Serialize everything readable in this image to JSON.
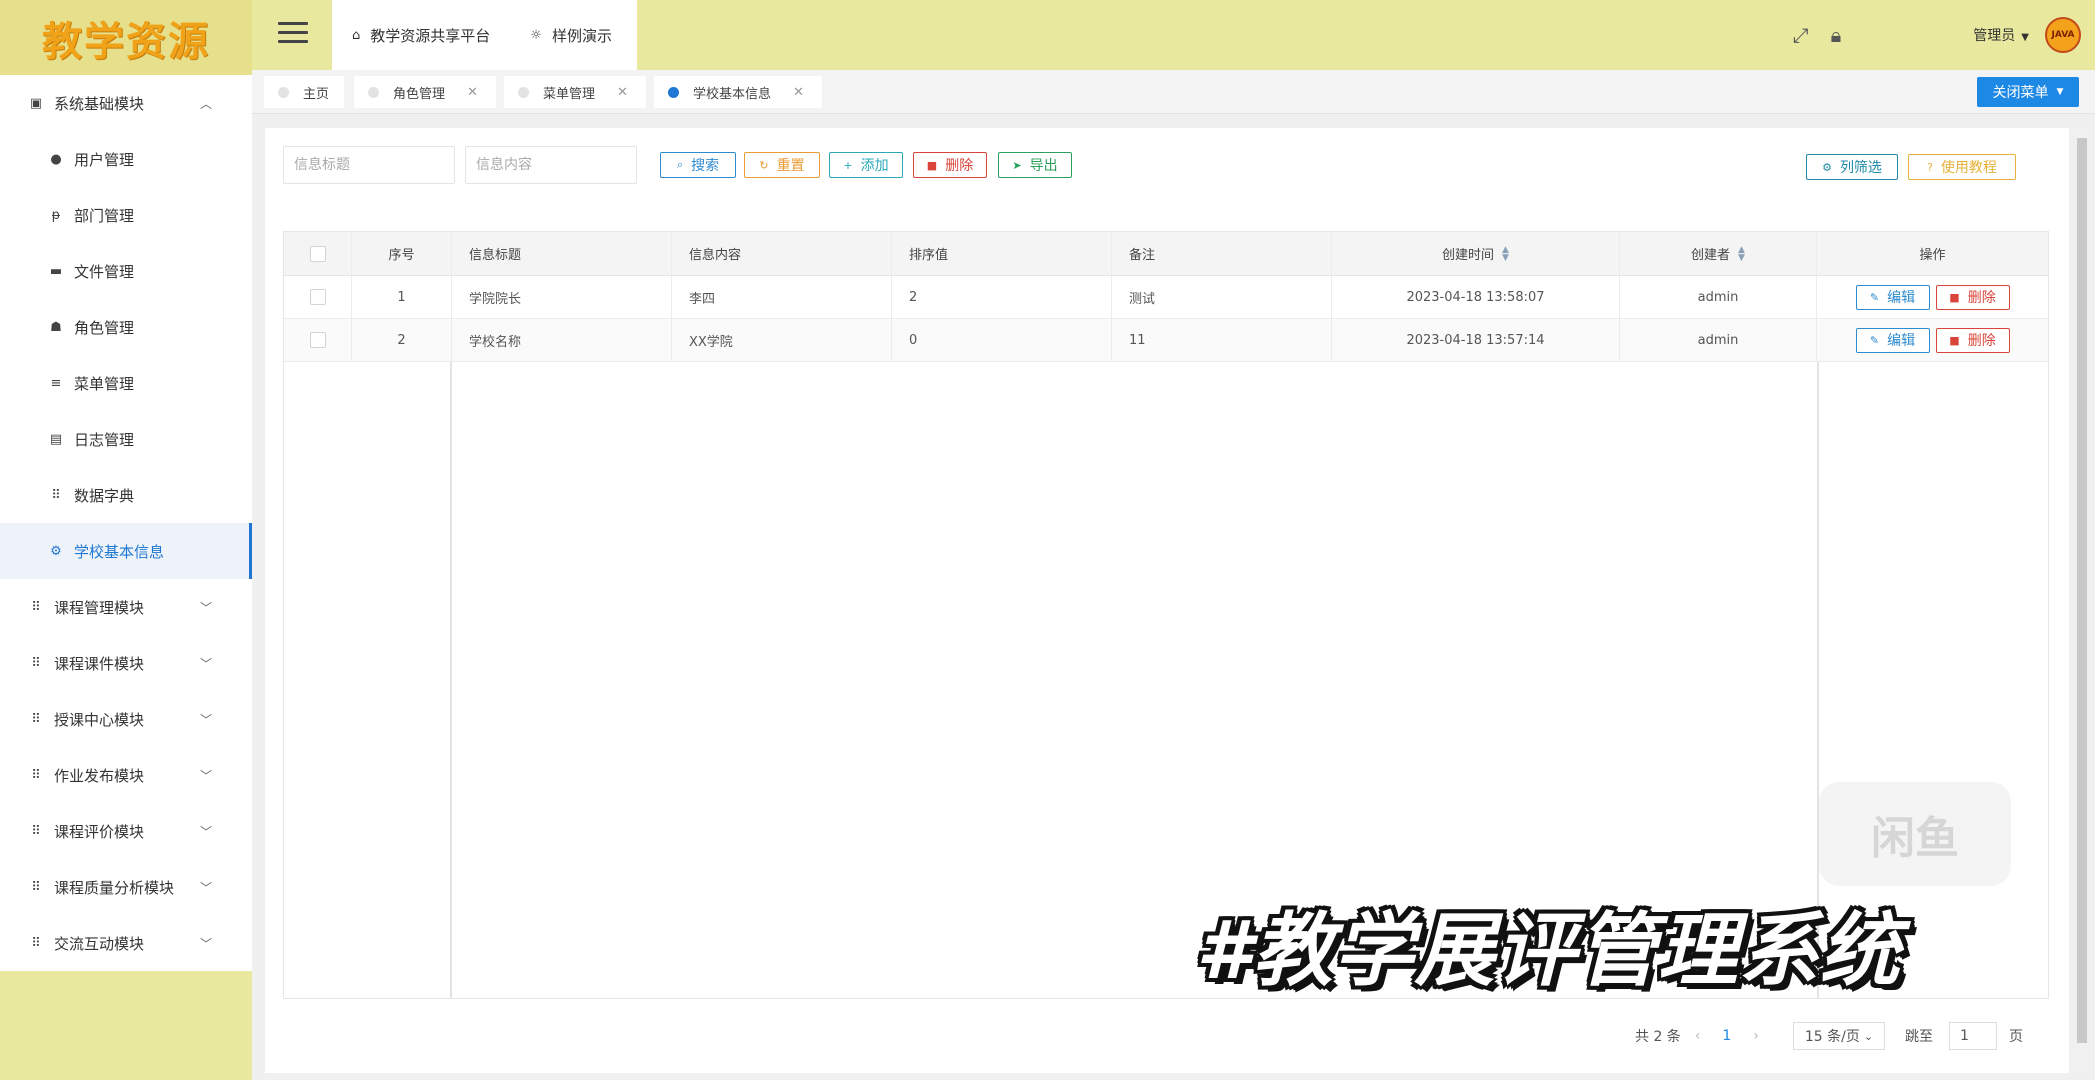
{
  "logo": "教学资源",
  "header": {
    "platform_tab": "教学资源共享平台",
    "demo_tab": "样例演示",
    "admin_label": "管理员",
    "avatar_text": "JAVA"
  },
  "sidebar": {
    "items": [
      {
        "label": "系统基础模块",
        "icon": "dashboard-icon",
        "expanded": true
      },
      {
        "label": "用户管理",
        "icon": "user-icon"
      },
      {
        "label": "部门管理",
        "icon": "department-icon"
      },
      {
        "label": "文件管理",
        "icon": "folder-icon"
      },
      {
        "label": "角色管理",
        "icon": "role-icon"
      },
      {
        "label": "菜单管理",
        "icon": "list-icon"
      },
      {
        "label": "日志管理",
        "icon": "log-icon"
      },
      {
        "label": "数据字典",
        "icon": "grid-icon"
      },
      {
        "label": "学校基本信息",
        "icon": "gear-icon",
        "active": true
      },
      {
        "label": "课程管理模块",
        "icon": "grid-icon"
      },
      {
        "label": "课程课件模块",
        "icon": "grid-icon"
      },
      {
        "label": "授课中心模块",
        "icon": "grid-icon"
      },
      {
        "label": "作业发布模块",
        "icon": "grid-icon"
      },
      {
        "label": "课程评价模块",
        "icon": "grid-icon"
      },
      {
        "label": "课程质量分析模块",
        "icon": "grid-icon"
      },
      {
        "label": "交流互动模块",
        "icon": "grid-icon"
      }
    ]
  },
  "pagetabs": {
    "items": [
      "主页",
      "角色管理",
      "菜单管理",
      "学校基本信息"
    ],
    "close_menu": "关闭菜单"
  },
  "toolbar": {
    "title_placeholder": "信息标题",
    "content_placeholder": "信息内容",
    "search": "搜索",
    "reset": "重置",
    "add": "添加",
    "delete": "删除",
    "export": "导出",
    "column_filter": "列筛选",
    "tutorial": "使用教程"
  },
  "table": {
    "headers": {
      "index": "序号",
      "title": "信息标题",
      "content": "信息内容",
      "order": "排序值",
      "remark": "备注",
      "created_at": "创建时间",
      "creator": "创建者",
      "actions": "操作"
    },
    "rows": [
      {
        "index": "1",
        "title": "学院院长",
        "content": "李四",
        "order": "2",
        "remark": "测试",
        "created_at": "2023-04-18 13:58:07",
        "creator": "admin"
      },
      {
        "index": "2",
        "title": "学校名称",
        "content": "XX学院",
        "order": "0",
        "remark": "11",
        "created_at": "2023-04-18 13:57:14",
        "creator": "admin"
      }
    ],
    "edit_label": "编辑",
    "delete_label": "删除"
  },
  "pagination": {
    "total": "共 2 条",
    "current_page": "1",
    "page_size": "15 条/页",
    "goto_label": "跳至",
    "goto_value": "1",
    "page_suffix": "页"
  },
  "watermark": "闲鱼",
  "overlay_title": "#教学展评管理系统"
}
